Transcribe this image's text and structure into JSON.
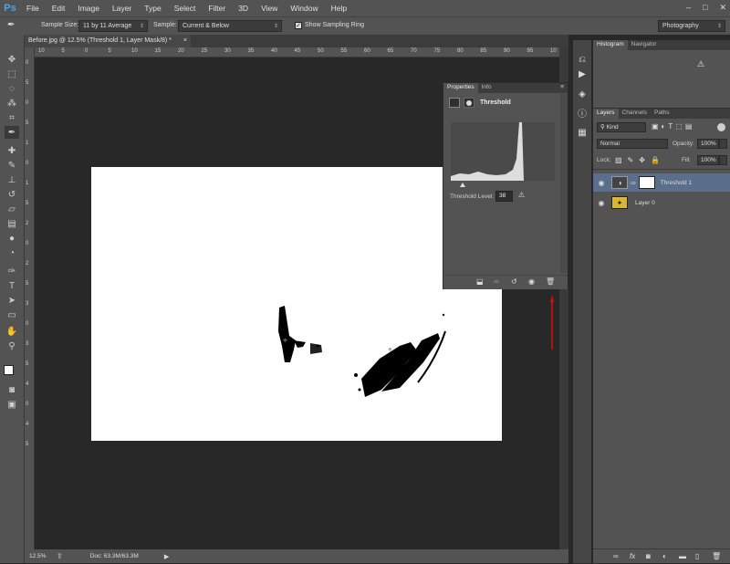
{
  "app": {
    "logo": "Ps"
  },
  "menu": [
    "File",
    "Edit",
    "Image",
    "Layer",
    "Type",
    "Select",
    "Filter",
    "3D",
    "View",
    "Window",
    "Help"
  ],
  "options": {
    "sample_size_label": "Sample Size:",
    "sample_size_value": "11 by 11 Average",
    "sample_label": "Sample:",
    "sample_value": "Current & Below",
    "show_ring_label": "Show Sampling Ring",
    "workspace_value": "Photography"
  },
  "document": {
    "tab_title": "Before.jpg @ 12.5% (Threshold 1, Layer Mask/8) *",
    "close_glyph": "×"
  },
  "ruler_top": [
    "10",
    "5",
    "0",
    "5",
    "10",
    "15",
    "20",
    "25",
    "30",
    "35",
    "40",
    "45",
    "50",
    "55",
    "60",
    "65",
    "70",
    "75",
    "80",
    "85",
    "90",
    "95",
    "10"
  ],
  "ruler_left": [
    "0",
    "5",
    "0",
    "5",
    "1",
    "0",
    "1",
    "5",
    "2",
    "0",
    "2",
    "5",
    "3",
    "0",
    "3",
    "5",
    "4",
    "0",
    "4",
    "5"
  ],
  "status": {
    "zoom": "12.5%",
    "doc": "Doc: 63.3M/63.3M"
  },
  "properties": {
    "tabs": [
      "Properties",
      "Info"
    ],
    "title": "Threshold",
    "threshold_label": "Threshold Level:",
    "threshold_value": "38"
  },
  "right": {
    "histogram_tabs": [
      "Histogram",
      "Navigator"
    ],
    "layers_tabs": [
      "Layers",
      "Channels",
      "Paths"
    ],
    "kind_label": "Kind",
    "blend_mode": "Normal",
    "opacity_label": "Opacity:",
    "opacity_value": "100%",
    "lock_label": "Lock:",
    "fill_label": "Fill:",
    "fill_value": "100%",
    "layers": [
      {
        "name": "Threshold 1"
      },
      {
        "name": "Layer 0"
      }
    ],
    "footer_fx": "fx"
  },
  "colors": {
    "accent": "#4da3e8",
    "arrow": "#d01010",
    "selected_layer": "#5b6e8c"
  }
}
